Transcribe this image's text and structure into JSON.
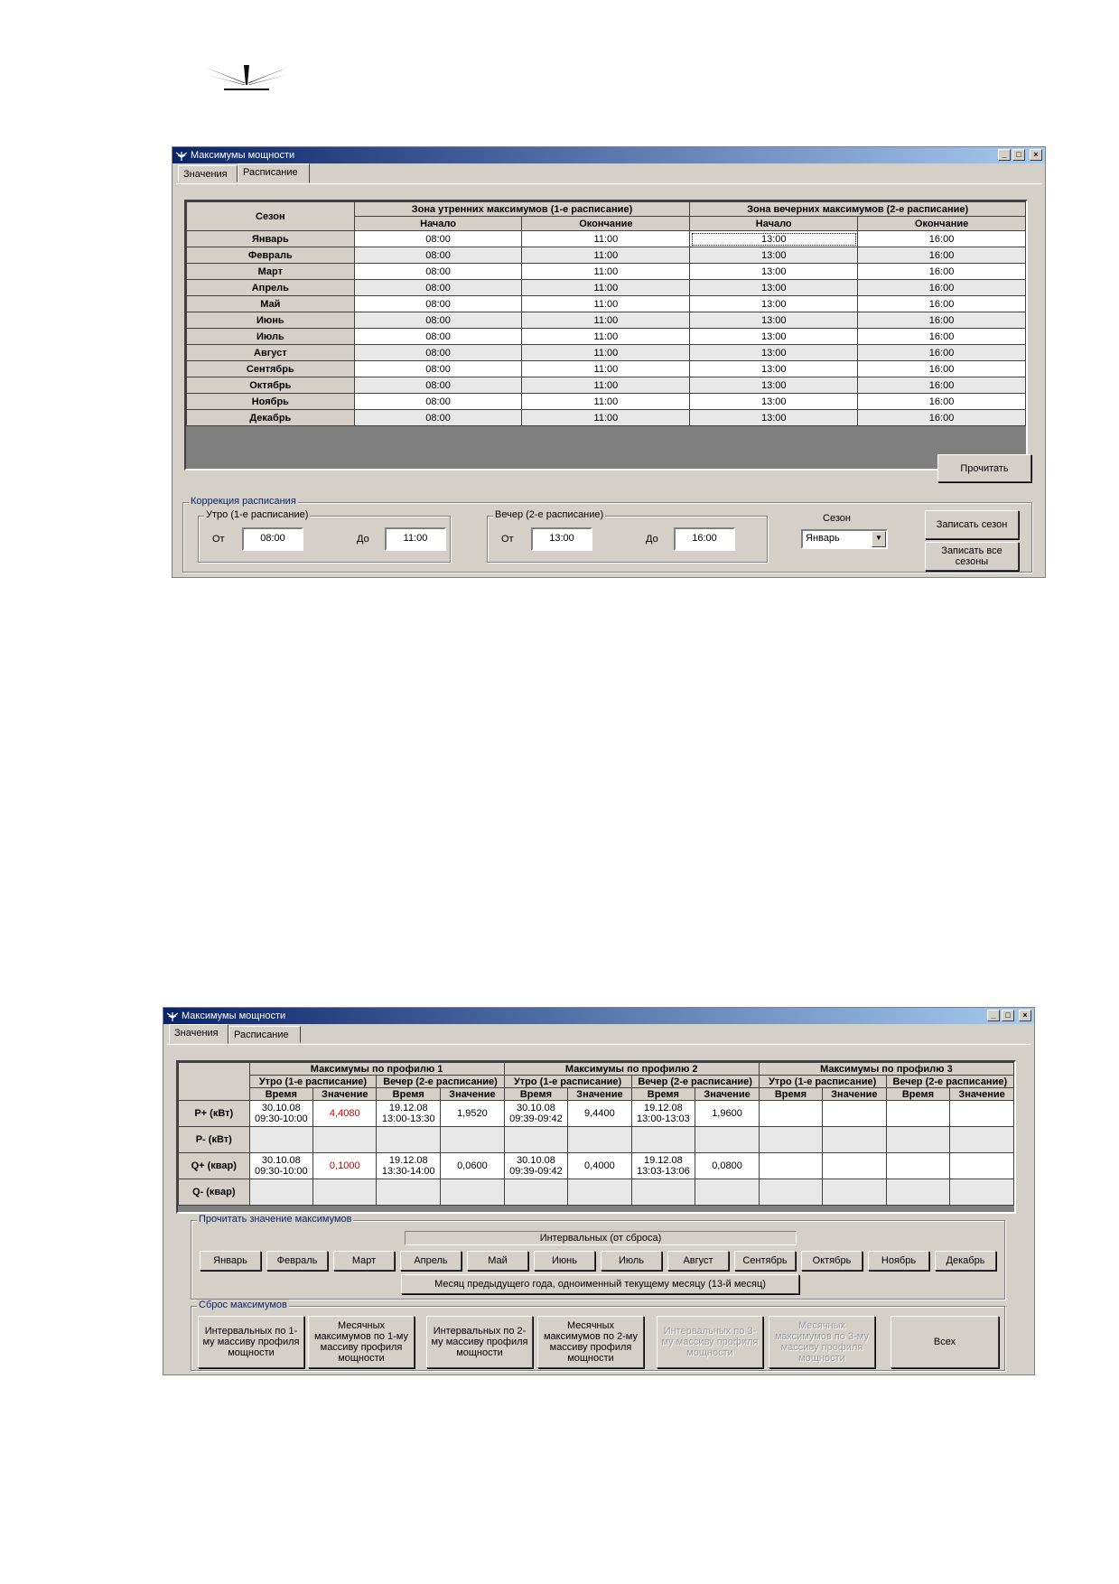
{
  "window1": {
    "title": "Максимумы мощности",
    "tabs": [
      "Значения",
      "Расписание"
    ],
    "table": {
      "season_header": "Сезон",
      "morning_zone": "Зона утренних максимумов (1-е расписание)",
      "evening_zone": "Зона вечерних максимумов (2-е расписание)",
      "start": "Начало",
      "end": "Окончание",
      "rows": [
        {
          "season": "Январь",
          "m_start": "08:00",
          "m_end": "11:00",
          "e_start": "13:00",
          "e_end": "16:00"
        },
        {
          "season": "Февраль",
          "m_start": "08:00",
          "m_end": "11:00",
          "e_start": "13:00",
          "e_end": "16:00"
        },
        {
          "season": "Март",
          "m_start": "08:00",
          "m_end": "11:00",
          "e_start": "13:00",
          "e_end": "16:00"
        },
        {
          "season": "Апрель",
          "m_start": "08:00",
          "m_end": "11:00",
          "e_start": "13:00",
          "e_end": "16:00"
        },
        {
          "season": "Май",
          "m_start": "08:00",
          "m_end": "11:00",
          "e_start": "13:00",
          "e_end": "16:00"
        },
        {
          "season": "Июнь",
          "m_start": "08:00",
          "m_end": "11:00",
          "e_start": "13:00",
          "e_end": "16:00"
        },
        {
          "season": "Июль",
          "m_start": "08:00",
          "m_end": "11:00",
          "e_start": "13:00",
          "e_end": "16:00"
        },
        {
          "season": "Август",
          "m_start": "08:00",
          "m_end": "11:00",
          "e_start": "13:00",
          "e_end": "16:00"
        },
        {
          "season": "Сентябрь",
          "m_start": "08:00",
          "m_end": "11:00",
          "e_start": "13:00",
          "e_end": "16:00"
        },
        {
          "season": "Октябрь",
          "m_start": "08:00",
          "m_end": "11:00",
          "e_start": "13:00",
          "e_end": "16:00"
        },
        {
          "season": "Ноябрь",
          "m_start": "08:00",
          "m_end": "11:00",
          "e_start": "13:00",
          "e_end": "16:00"
        },
        {
          "season": "Декабрь",
          "m_start": "08:00",
          "m_end": "11:00",
          "e_start": "13:00",
          "e_end": "16:00"
        }
      ]
    },
    "read_button": "Прочитать",
    "correction": {
      "title": "Коррекция расписания",
      "morning_title": "Утро (1-е расписание)",
      "evening_title": "Вечер (2-е расписание)",
      "from_label": "От",
      "to_label": "До",
      "morning_from": "08:00",
      "morning_to": "11:00",
      "evening_from": "13:00",
      "evening_to": "16:00",
      "season_label": "Сезон",
      "season_value": "Январь",
      "write_season": "Записать сезон",
      "write_all": "Записать все сезоны"
    }
  },
  "window2": {
    "title": "Максимумы мощности",
    "tabs": [
      "Значения",
      "Расписание"
    ],
    "table": {
      "profiles": [
        "Максимумы по профилю 1",
        "Максимумы по профилю 2",
        "Максимумы по профилю 3"
      ],
      "morning": "Утро (1-е расписание)",
      "evening": "Вечер (2-е расписание)",
      "time": "Время",
      "value": "Значение",
      "rows": [
        {
          "label": "P+ (кВт)",
          "cells": [
            {
              "t1": "30.10.08",
              "t2": "09:30-10:00"
            },
            {
              "v": "4,4080",
              "red": true
            },
            {
              "t1": "19.12.08",
              "t2": "13:00-13:30"
            },
            {
              "v": "1,9520"
            },
            {
              "t1": "30.10.08",
              "t2": "09:39-09:42"
            },
            {
              "v": "9,4400"
            },
            {
              "t1": "19.12.08",
              "t2": "13:00-13:03"
            },
            {
              "v": "1,9600"
            },
            {},
            {},
            {},
            {}
          ]
        },
        {
          "label": "P- (кВт)",
          "cells": [
            {},
            {},
            {},
            {},
            {},
            {},
            {},
            {},
            {},
            {},
            {},
            {}
          ]
        },
        {
          "label": "Q+ (квар)",
          "cells": [
            {
              "t1": "30.10.08",
              "t2": "09:30-10:00"
            },
            {
              "v": "0,1000",
              "red": true
            },
            {
              "t1": "19.12.08",
              "t2": "13:30-14:00"
            },
            {
              "v": "0,0600"
            },
            {
              "t1": "30.10.08",
              "t2": "09:39-09:42"
            },
            {
              "v": "0,4000"
            },
            {
              "t1": "19.12.08",
              "t2": "13:03-13:06"
            },
            {
              "v": "0,0800"
            },
            {},
            {},
            {},
            {}
          ]
        },
        {
          "label": "Q- (квар)",
          "cells": [
            {},
            {},
            {},
            {},
            {},
            {},
            {},
            {},
            {},
            {},
            {},
            {}
          ]
        }
      ]
    },
    "read_group": {
      "title": "Прочитать значение максимумов",
      "interval": "Интервальных (от сброса)",
      "months": [
        "Январь",
        "Февраль",
        "Март",
        "Апрель",
        "Май",
        "Июнь",
        "Июль",
        "Август",
        "Сентябрь",
        "Октябрь",
        "Ноябрь",
        "Декабрь"
      ],
      "prev_year": "Месяц предыдущего года, одноименный текущему месяцу (13-й месяц)"
    },
    "reset_group": {
      "title": "Сброс максимумов",
      "buttons": [
        {
          "label": "Интервальных по 1-му массиву профиля мощности",
          "disabled": false
        },
        {
          "label": "Месячных максимумов по 1-му массиву профиля мощности",
          "disabled": false
        },
        {
          "label": "Интервальных по 2-му массиву профиля мощности",
          "disabled": false
        },
        {
          "label": "Месячных максимумов по 2-му массиву профиля мощности",
          "disabled": false
        },
        {
          "label": "Интервальных по 3-му массиву профиля мощности",
          "disabled": true
        },
        {
          "label": "Месячных максимумов по 3-му массиву профиля мощности",
          "disabled": true
        },
        {
          "label": "Всех",
          "disabled": false
        }
      ]
    }
  }
}
